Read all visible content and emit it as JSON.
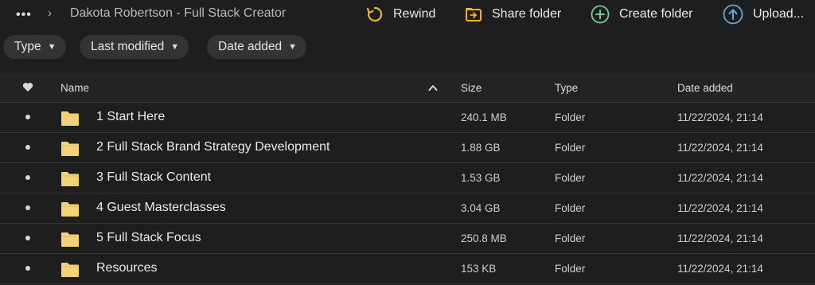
{
  "breadcrumb": {
    "more": "•••",
    "title": "Dakota Robertson - Full Stack Creator"
  },
  "toolbar": {
    "rewind": "Rewind",
    "share_folder": "Share folder",
    "create_folder": "Create folder",
    "upload": "Upload..."
  },
  "filters": {
    "type": "Type",
    "last_modified": "Last modified",
    "date_added": "Date added"
  },
  "table": {
    "headers": {
      "name": "Name",
      "size": "Size",
      "type": "Type",
      "date_added": "Date added"
    },
    "rows": [
      {
        "name": "1 Start Here",
        "size": "240.1 MB",
        "type": "Folder",
        "date": "11/22/2024, 21:14"
      },
      {
        "name": "2 Full Stack Brand Strategy Development",
        "size": "1.88 GB",
        "type": "Folder",
        "date": "11/22/2024, 21:14"
      },
      {
        "name": "3 Full Stack Content",
        "size": "1.53 GB",
        "type": "Folder",
        "date": "11/22/2024, 21:14"
      },
      {
        "name": "4 Guest Masterclasses",
        "size": "3.04 GB",
        "type": "Folder",
        "date": "11/22/2024, 21:14"
      },
      {
        "name": "5 Full Stack Focus",
        "size": "250.8 MB",
        "type": "Folder",
        "date": "11/22/2024, 21:14"
      },
      {
        "name": "Resources",
        "size": "153 KB",
        "type": "Folder",
        "date": "11/22/2024, 21:14"
      }
    ]
  },
  "colors": {
    "background": "#1e1e1e",
    "folder": "#f3d27a",
    "rewind_icon": "#f0b429",
    "create_icon": "#6fcf97",
    "upload_icon": "#5aa9e6"
  }
}
